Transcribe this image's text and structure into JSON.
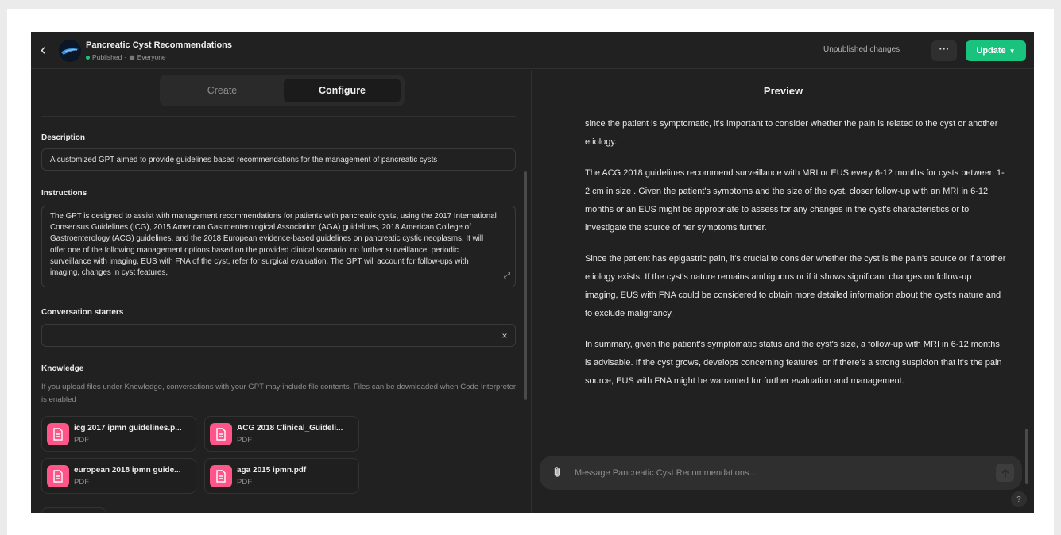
{
  "header": {
    "gpt_name": "Pancreatic Cyst Recommendations",
    "status": "Published",
    "separator": "·",
    "audience_icon": "people-icon",
    "audience": "Everyone",
    "unpublished": "Unpublished changes",
    "more_label": "···",
    "update_label": "Update"
  },
  "tabs": {
    "create": "Create",
    "configure": "Configure",
    "active": "configure"
  },
  "description": {
    "label": "Description",
    "value": "A customized GPT aimed to provide guidelines based recommendations for the management of pancreatic cysts"
  },
  "instructions": {
    "label": "Instructions",
    "value": "The GPT is designed to assist with management recommendations for patients with pancreatic cysts, using the 2017 International Consensus Guidelines (ICG), 2015 American Gastroenterological Association (AGA) guidelines, 2018 American College of Gastroenterology (ACG) guidelines, and the 2018 European evidence-based guidelines on pancreatic cystic neoplasms. It will offer one of the following management options based on the provided clinical scenario: no further surveillance, periodic surveillance with imaging, EUS with FNA of the cyst, refer for surgical evaluation. The GPT will account for follow-ups with imaging, changes in cyst features,"
  },
  "conversation_starters": {
    "label": "Conversation starters",
    "value": "",
    "clear_label": "×"
  },
  "knowledge": {
    "label": "Knowledge",
    "hint": "If you upload files under Knowledge, conversations with your GPT may include file contents. Files can be downloaded when Code Interpreter is enabled",
    "files": [
      {
        "name": "icg 2017 ipmn guidelines.p...",
        "type": "PDF"
      },
      {
        "name": "ACG 2018 Clinical_Guideli...",
        "type": "PDF"
      },
      {
        "name": "european 2018 ipmn guide...",
        "type": "PDF"
      },
      {
        "name": "aga 2015 ipmn.pdf",
        "type": "PDF"
      }
    ]
  },
  "preview": {
    "title": "Preview",
    "messages": [
      "since the patient is symptomatic, it's important to consider whether the pain is related to the cyst or another etiology.",
      "The ACG 2018 guidelines recommend surveillance with MRI or EUS every 6-12 months for cysts between 1-2 cm in size . Given the patient's symptoms and the size of the cyst, closer follow-up with an MRI in 6-12 months or an EUS might be appropriate to assess for any changes in the cyst's characteristics or to investigate the source of her symptoms further.",
      "Since the patient has epigastric pain, it's crucial to consider whether the cyst is the pain's source or if another etiology exists. If the cyst's nature remains ambiguous or if it shows significant changes on follow-up imaging, EUS with FNA could be considered to obtain more detailed information about the cyst's nature and to exclude malignancy.",
      "In summary, given the patient's symptomatic status and the cyst's size, a follow-up with MRI in 6-12 months is advisable. If the cyst grows, develops concerning features, or if there's a strong suspicion that it's the pain source, EUS with FNA might be warranted for further evaluation and management."
    ],
    "composer_placeholder": "Message Pancreatic Cyst Recommendations...",
    "help_label": "?"
  },
  "colors": {
    "accent": "#19c37d",
    "file_icon": "#ff5588",
    "background": "#212121"
  },
  "icons": [
    "back-arrow-icon",
    "gpt-avatar",
    "people-icon",
    "more-icon",
    "chevron-down-icon",
    "expand-icon",
    "close-icon",
    "document-icon",
    "paperclip-icon",
    "send-arrow-icon",
    "help-icon"
  ]
}
